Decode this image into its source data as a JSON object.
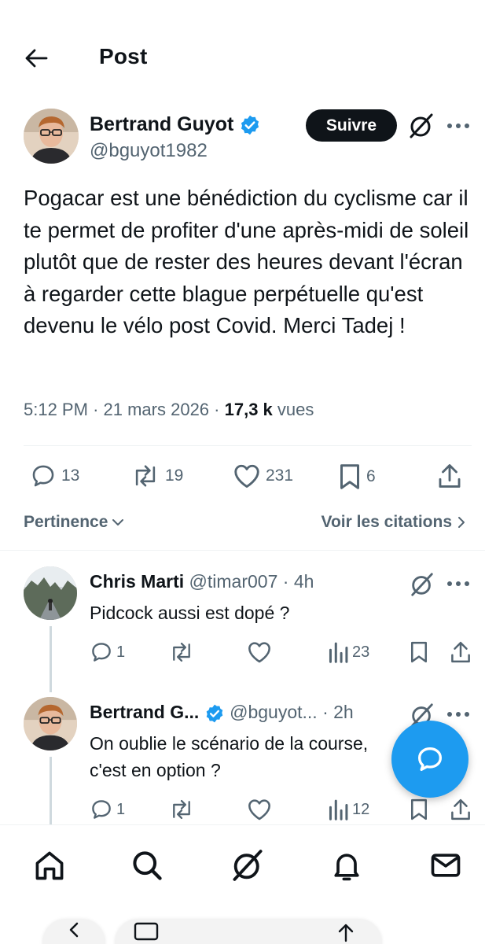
{
  "header": {
    "title": "Post"
  },
  "post": {
    "author_name": "Bertrand Guyot",
    "author_handle": "@bguyot1982",
    "follow_label": "Suivre",
    "text": "Pogacar est une bénédiction du cyclisme car il te permet de profiter d'une après-midi de soleil plutôt que de rester des heures devant l'écran à regarder cette blague perpétuelle qu'est devenu le vélo post Covid. Merci Tadej !",
    "time": "5:12 PM",
    "date": "21 mars 2026",
    "views_count": "17,3 k",
    "views_label": "vues",
    "replies": "13",
    "reposts": "19",
    "likes": "231",
    "bookmarks": "6"
  },
  "sort": {
    "left_label": "Pertinence",
    "right_label": "Voir les citations"
  },
  "replies": [
    {
      "name": "Chris Marti",
      "handle": "@timar007",
      "time": "4h",
      "text": "Pidcock aussi est dopé ?",
      "replies": "1",
      "views": "23"
    },
    {
      "name": "Bertrand G...",
      "handle": "@bguyot...",
      "time": "2h",
      "text": "On oublie le scénario de la course, c'est en option ?",
      "replies": "1",
      "views": "12"
    }
  ],
  "colors": {
    "accent": "#1d9bf0",
    "text": "#0f1419",
    "muted": "#536471"
  },
  "icons": [
    "back-arrow-icon",
    "verified-icon",
    "grok-icon",
    "more-icon",
    "reply-icon",
    "repost-icon",
    "like-icon",
    "bookmark-icon",
    "share-icon",
    "views-icon",
    "home-icon",
    "search-icon",
    "notifications-icon",
    "messages-icon",
    "compose-icon"
  ]
}
